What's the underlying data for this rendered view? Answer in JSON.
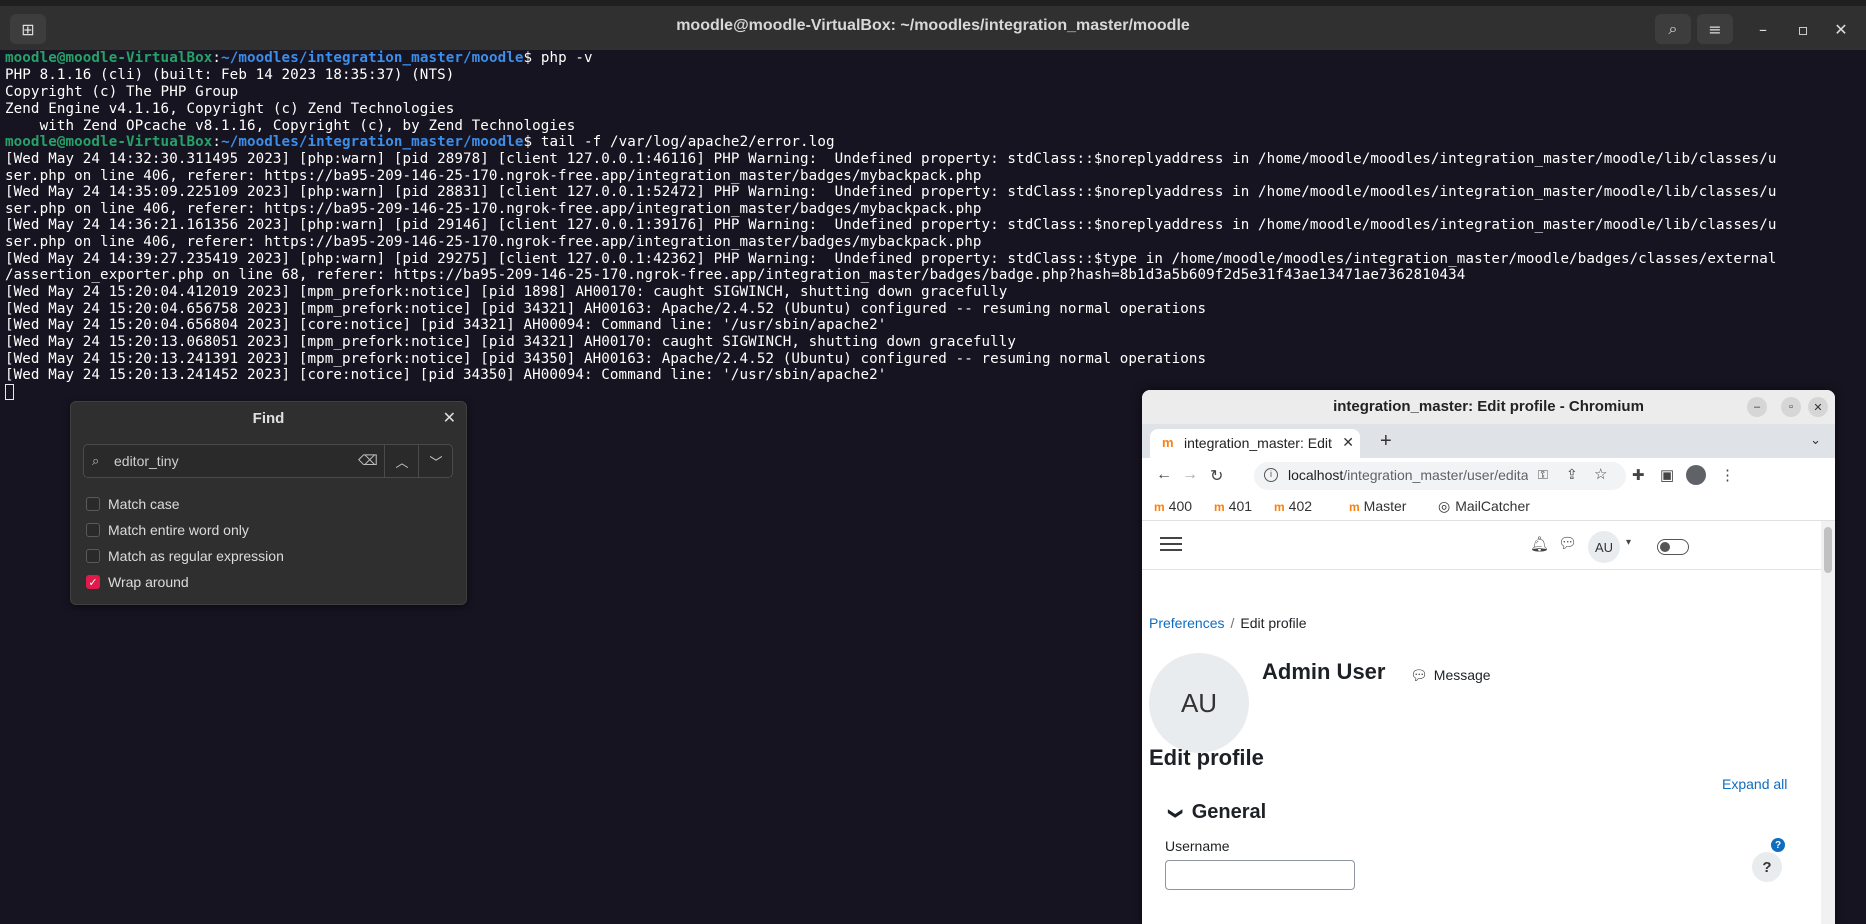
{
  "terminal": {
    "title": "moodle@moodle-VirtualBox: ~/moodles/integration_master/moodle",
    "prompt_user": "moodle@moodle-VirtualBox",
    "prompt_path": "~/moodles/integration_master/moodle",
    "lines": {
      "l0_cmd": "$ php -v",
      "l1": "PHP 8.1.16 (cli) (built: Feb 14 2023 18:35:37) (NTS)",
      "l2": "Copyright (c) The PHP Group",
      "l3": "Zend Engine v4.1.16, Copyright (c) Zend Technologies",
      "l4": "    with Zend OPcache v8.1.16, Copyright (c), by Zend Technologies",
      "l5_cmd": "$ tail -f /var/log/apache2/error.log",
      "l6": "[Wed May 24 14:32:30.311495 2023] [php:warn] [pid 28978] [client 127.0.0.1:46116] PHP Warning:  Undefined property: stdClass::$noreplyaddress in /home/moodle/moodles/integration_master/moodle/lib/classes/u",
      "l7": "ser.php on line 406, referer: https://ba95-209-146-25-170.ngrok-free.app/integration_master/badges/mybackpack.php",
      "l8": "[Wed May 24 14:35:09.225109 2023] [php:warn] [pid 28831] [client 127.0.0.1:52472] PHP Warning:  Undefined property: stdClass::$noreplyaddress in /home/moodle/moodles/integration_master/moodle/lib/classes/u",
      "l9": "ser.php on line 406, referer: https://ba95-209-146-25-170.ngrok-free.app/integration_master/badges/mybackpack.php",
      "l10": "[Wed May 24 14:36:21.161356 2023] [php:warn] [pid 29146] [client 127.0.0.1:39176] PHP Warning:  Undefined property: stdClass::$noreplyaddress in /home/moodle/moodles/integration_master/moodle/lib/classes/u",
      "l11": "ser.php on line 406, referer: https://ba95-209-146-25-170.ngrok-free.app/integration_master/badges/mybackpack.php",
      "l12": "[Wed May 24 14:39:27.235419 2023] [php:warn] [pid 29275] [client 127.0.0.1:42362] PHP Warning:  Undefined property: stdClass::$type in /home/moodle/moodles/integration_master/moodle/badges/classes/external",
      "l13": "/assertion_exporter.php on line 68, referer: https://ba95-209-146-25-170.ngrok-free.app/integration_master/badges/badge.php?hash=8b1d3a5b609f2d5e31f43ae13471ae7362810434",
      "l14": "[Wed May 24 15:20:04.412019 2023] [mpm_prefork:notice] [pid 1898] AH00170: caught SIGWINCH, shutting down gracefully",
      "l15": "[Wed May 24 15:20:04.656758 2023] [mpm_prefork:notice] [pid 34321] AH00163: Apache/2.4.52 (Ubuntu) configured -- resuming normal operations",
      "l16": "[Wed May 24 15:20:04.656804 2023] [core:notice] [pid 34321] AH00094: Command line: '/usr/sbin/apache2'",
      "l17": "[Wed May 24 15:20:13.068051 2023] [mpm_prefork:notice] [pid 34321] AH00170: caught SIGWINCH, shutting down gracefully",
      "l18": "[Wed May 24 15:20:13.241391 2023] [mpm_prefork:notice] [pid 34350] AH00163: Apache/2.4.52 (Ubuntu) configured -- resuming normal operations",
      "l19": "[Wed May 24 15:20:13.241452 2023] [core:notice] [pid 34350] AH00094: Command line: '/usr/sbin/apache2'"
    }
  },
  "find_dialog": {
    "title": "Find",
    "search_value": "editor_tiny",
    "options": [
      {
        "label": "Match case",
        "checked": false
      },
      {
        "label": "Match entire word only",
        "checked": false
      },
      {
        "label": "Match as regular expression",
        "checked": false
      },
      {
        "label": "Wrap around",
        "checked": true
      }
    ]
  },
  "browser": {
    "window_title": "integration_master: Edit profile - Chromium",
    "tab_label": "integration_master: Edit profile",
    "url_host": "localhost",
    "url_path": "/integration_master/user/editadvanc...",
    "bookmarks": [
      "400",
      "401",
      "402",
      "Master",
      "MailCatcher"
    ]
  },
  "moodle": {
    "user_initials": "AU",
    "breadcrumb": {
      "parent": "Preferences",
      "current": "Edit profile"
    },
    "user_name": "Admin User",
    "message_label": "Message",
    "page_heading": "Edit profile",
    "expand_all": "Expand all",
    "section_general": "General",
    "username_label": "Username"
  }
}
